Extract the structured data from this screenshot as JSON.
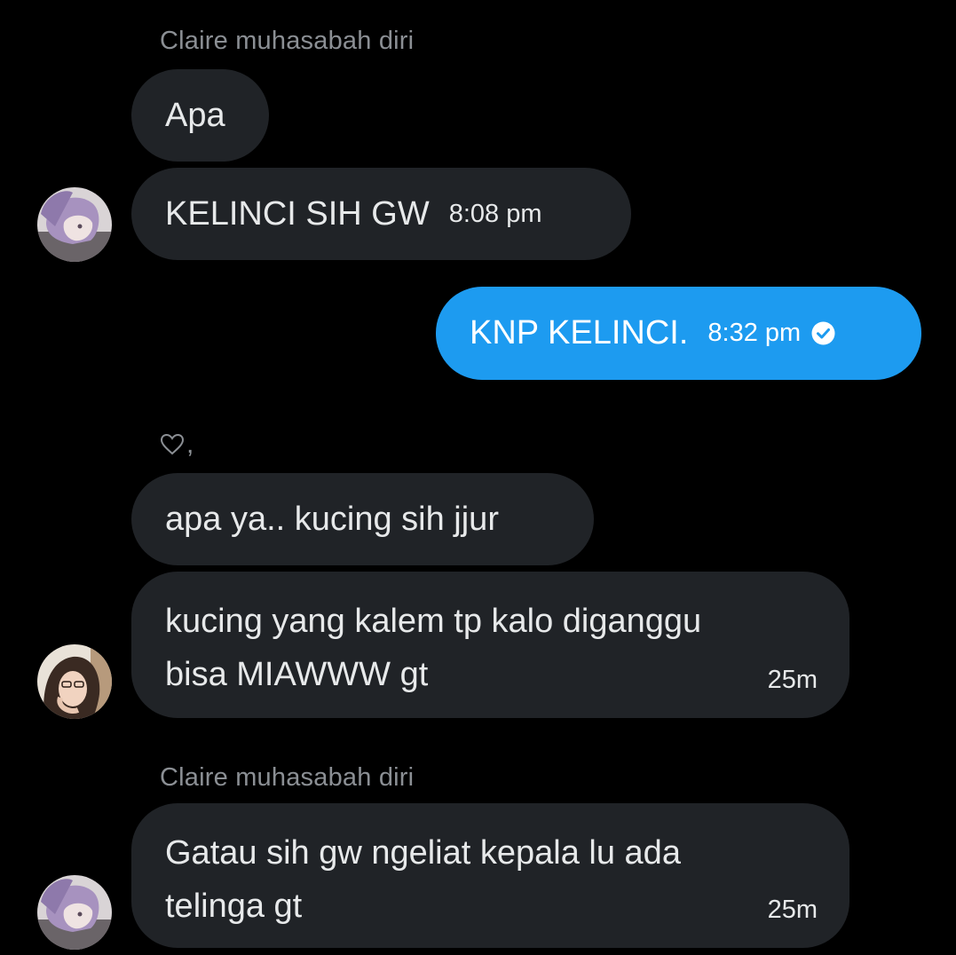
{
  "conversation": {
    "group1": {
      "sender_name": "Claire muhasabah diri",
      "messages": [
        {
          "text": "Apa"
        },
        {
          "text": "KELINCI SIH GW",
          "time": "8:08 pm"
        }
      ],
      "avatar": "user-avatar"
    },
    "outgoing": {
      "text": "KNP KELINCI.",
      "time": "8:32 pm",
      "status_icon": "sent-check-icon",
      "color": "#1d9bf0"
    },
    "reply_marker": {
      "icon": "heart-outline-icon",
      "text": ","
    },
    "group2": {
      "messages": [
        {
          "text": "apa ya.. kucing sih jjur"
        },
        {
          "text": "kucing yang kalem tp kalo diganggu\nbisa MIAWWW gt",
          "time": "25m"
        }
      ],
      "avatar": "user-avatar"
    },
    "group3": {
      "sender_name": "Claire muhasabah diri",
      "messages": [
        {
          "text": "Gatau sih gw ngeliat kepala lu ada\ntelinga gt",
          "time": "25m"
        }
      ],
      "avatar": "user-avatar"
    }
  },
  "theme": {
    "background": "#000000",
    "incoming_bubble": "#202327",
    "muted_text": "#8b8f94"
  }
}
